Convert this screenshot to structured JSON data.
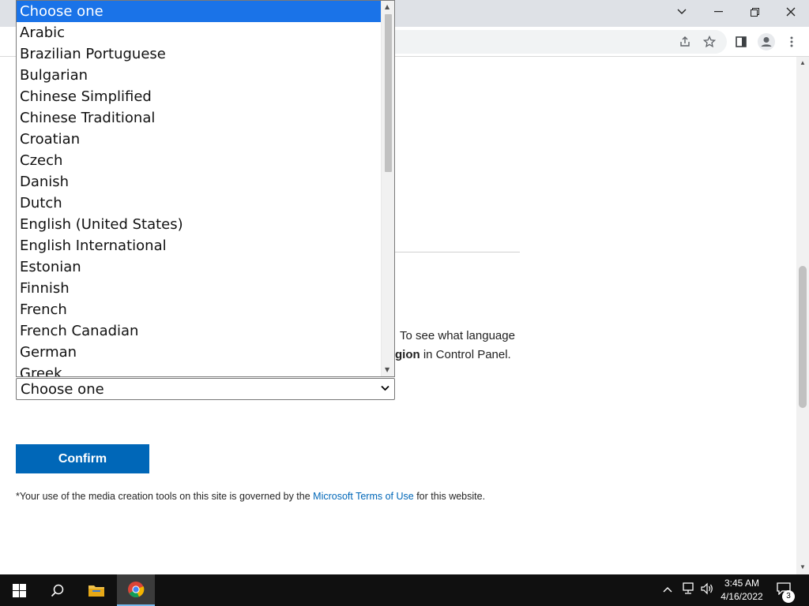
{
  "dropdown": {
    "options": [
      "Choose one",
      "Arabic",
      "Brazilian Portuguese",
      "Bulgarian",
      "Chinese Simplified",
      "Chinese Traditional",
      "Croatian",
      "Czech",
      "Danish",
      "Dutch",
      "English (United States)",
      "English International",
      "Estonian",
      "Finnish",
      "French",
      "French Canadian",
      "German",
      "Greek"
    ],
    "selected_index": 0
  },
  "select": {
    "value": "Choose one"
  },
  "instructions": {
    "line1_visible": "To see what language",
    "line2_bold": "gion",
    "line2_rest": " in Control Panel."
  },
  "confirm_label": "Confirm",
  "footnote": {
    "prefix": "*Your use of the media creation tools on this site is governed by the ",
    "link": "Microsoft Terms of Use",
    "suffix": " for this website."
  },
  "taskbar": {
    "time": "3:45 AM",
    "date": "4/16/2022",
    "notification_count": "3"
  },
  "colors": {
    "accent": "#0067b8",
    "selection": "#1a73e8",
    "taskbar": "#101010"
  }
}
